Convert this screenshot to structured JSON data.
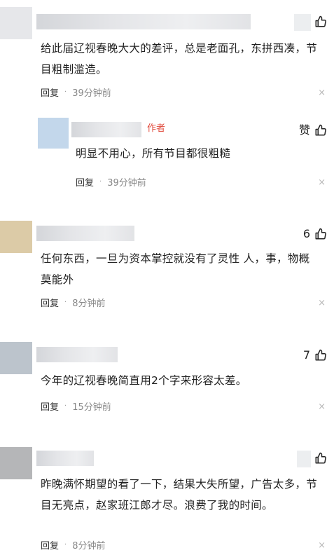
{
  "comments": [
    {
      "text": "给此届辽视春晚大大的差评，总是老面孔，东拼西凑，节目粗制滥造。",
      "reply_label": "回复",
      "time": "39分钟前",
      "likes": "",
      "avatar_color": "#e6e7ea"
    },
    {
      "author_tag": "作者",
      "text": "明显不用心，所有节目都很粗糙",
      "reply_label": "回复",
      "time": "39分钟前",
      "likes": "赞",
      "avatar_color": "#c3d7eb"
    },
    {
      "text": "任何东西，一旦为资本掌控就没有了灵性 人，事，物概莫能外",
      "reply_label": "回复",
      "time": "8分钟前",
      "likes": "6",
      "avatar_color": "#dccba7"
    },
    {
      "text": "今年的辽视春晚简直用2个字来形容太差。",
      "reply_label": "回复",
      "time": "15分钟前",
      "likes": "7",
      "avatar_color": "#bcc4cc"
    },
    {
      "text": "昨晚满怀期望的看了一下，结果大失所望，广告太多，节目无亮点，赵家班江郎才尽。浪费了我的时间。",
      "reply_label": "回复",
      "time": "8分钟前",
      "likes": "",
      "avatar_color": "#b5b6b8"
    }
  ],
  "icons": {
    "like": "thumbs-up-icon",
    "close": "close-icon",
    "separator": "·",
    "close_glyph": "×"
  }
}
